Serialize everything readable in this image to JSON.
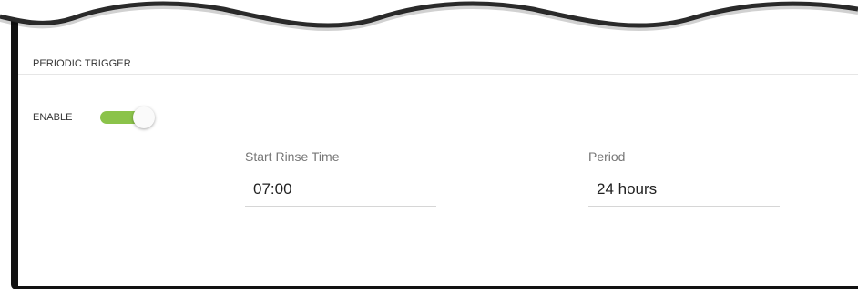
{
  "section": {
    "title": "PERIODIC TRIGGER"
  },
  "enable": {
    "label": "ENABLE",
    "enabled": true,
    "accent_color": "#8bc34a"
  },
  "fields": {
    "start_rinse_time": {
      "label": "Start Rinse Time",
      "value": "07:00"
    },
    "period": {
      "label": "Period",
      "value": "24 hours"
    }
  }
}
